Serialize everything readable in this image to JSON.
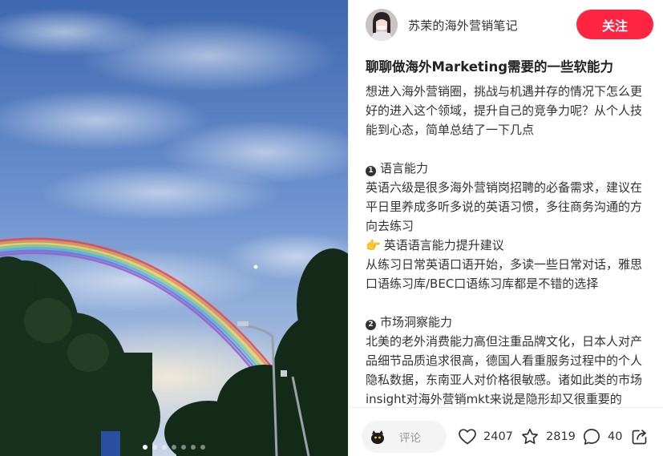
{
  "author": {
    "name": "苏茉的海外营销笔记",
    "avatar_icon": "user-avatar-icon"
  },
  "follow_button": {
    "label": "关注",
    "color": "#ff2442"
  },
  "note": {
    "title": "聊聊做海外Marketing需要的一些软能力",
    "intro": "想进入海外营销圈，挑战与机遇并存的情况下怎么更好的进入这个领域，提升自己的竞争力呢？从个人技能到心态，简单总结了一下几点",
    "sections": [
      {
        "number": "1",
        "heading": "语言能力",
        "text": "英语六级是很多海外营销岗招聘的必备需求，建议在平日里养成多听多说的英语习惯，多往商务沟通的方向去练习",
        "tip_emoji": "👉",
        "tip_heading": "英语语言能力提升建议",
        "tip_text": "从练习日常英语口语开始，多读一些日常对话，雅思口语练习库/BEC口语练习库都是不错的选择"
      },
      {
        "number": "2",
        "heading": "市场洞察能力",
        "text": "北美的老外消费能力高但注重品牌文化，日本人对产品细节品质追求很高，德国人看重服务过程中的个人隐私数据，东南亚人对价格很敏感。诸如此类的市场insight对海外营销mkt来说是隐形却又很重要的"
      }
    ]
  },
  "image": {
    "description_icon": "rainbow-photo",
    "dots_total": 7,
    "dots_active": 1
  },
  "bottom_bar": {
    "comment_placeholder": "评论",
    "likes": "2407",
    "collects": "2819",
    "comments": "40",
    "icons": [
      "heart-icon",
      "star-icon",
      "comment-bubble-icon",
      "share-icon"
    ]
  }
}
